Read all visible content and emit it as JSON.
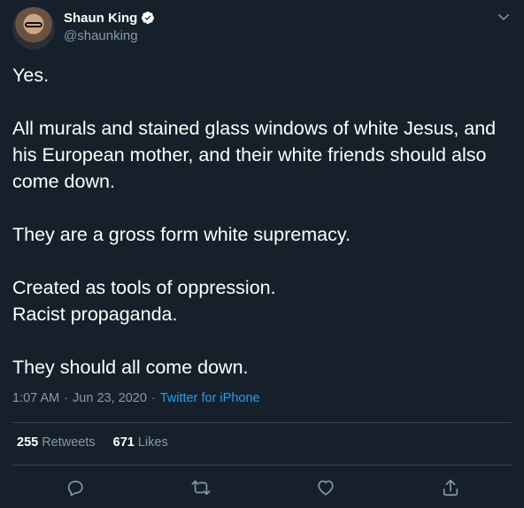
{
  "author": {
    "display_name": "Shaun King",
    "handle": "@shaunking",
    "verified": true,
    "verified_color": "#ffffff"
  },
  "tweet": {
    "text": "Yes.\n\nAll murals and stained glass windows of white Jesus, and his European mother, and their white friends should also come down.\n\nThey are a gross form white supremacy.\n\nCreated as tools of oppression.\nRacist propaganda.\n\nThey should all come down.",
    "time": "1:07 AM",
    "date": "Jun 23, 2020",
    "source": "Twitter for iPhone",
    "separator": "·"
  },
  "stats": {
    "retweets_count": "255",
    "retweets_label": "Retweets",
    "likes_count": "671",
    "likes_label": "Likes"
  },
  "actions": {
    "reply_icon": "reply-icon",
    "retweet_icon": "retweet-icon",
    "like_icon": "heart-icon",
    "share_icon": "share-icon"
  },
  "colors": {
    "background": "#15202b",
    "text": "#ffffff",
    "secondary": "#8899a6",
    "accent": "#1da1f2",
    "divider": "#38444d"
  }
}
